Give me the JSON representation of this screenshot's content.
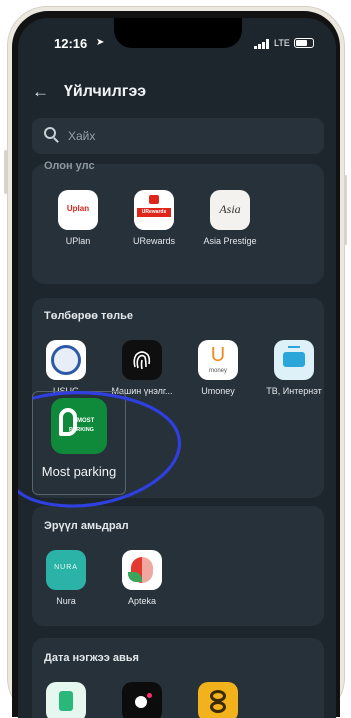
{
  "status_bar": {
    "time": "12:16",
    "network": "LTE"
  },
  "header": {
    "back_icon": "arrow-left-icon",
    "title": "Үйлчилгээ"
  },
  "search": {
    "placeholder": "Хайх"
  },
  "sections": [
    {
      "title": "Олон улс",
      "apps": [
        {
          "label": "UPlan",
          "icon": "uplan-logo"
        },
        {
          "label": "URewards",
          "icon": "urewards-logo"
        },
        {
          "label": "Asia Prestige",
          "icon": "asia-prestige-logo"
        }
      ]
    },
    {
      "title": "Төлбөрөө төлье",
      "apps": [
        {
          "label": "USUG",
          "icon": "usug-logo"
        },
        {
          "label": "Машин үнэлг...",
          "icon": "fingerprint-icon"
        },
        {
          "label": "Umoney",
          "icon": "umoney-logo"
        },
        {
          "label": "ТВ, Интернэт",
          "icon": "tv-icon"
        },
        {
          "label": "Most parking",
          "icon": "most-parking-logo"
        }
      ]
    },
    {
      "title": "Эрүүл амьдрал",
      "apps": [
        {
          "label": "Nura",
          "icon": "nura-logo"
        },
        {
          "label": "Apteka",
          "icon": "apteka-logo"
        }
      ]
    },
    {
      "title": "Дата нэгжээ авья",
      "apps": [
        {
          "label": "",
          "icon": "data-app-green-icon"
        },
        {
          "label": "",
          "icon": "data-app-black-icon"
        },
        {
          "label": "",
          "icon": "data-app-yellow-icon"
        }
      ]
    }
  ],
  "icon_texts": {
    "uplan": "Uplan",
    "urewards": "URewards",
    "asia": "Asia",
    "umoney_mark": "U",
    "umoney_text": "money",
    "nura": "NURA",
    "parking_most": "MOST",
    "parking_word": "PARKING"
  },
  "annotation": {
    "color": "#2f3fe0",
    "shape": "hand-drawn circle"
  },
  "colors": {
    "screen_bg": "#1d262d",
    "card_bg": "#26313a",
    "most_parking_green": "#0e8a3a",
    "nura_teal": "#2bb3a7"
  }
}
